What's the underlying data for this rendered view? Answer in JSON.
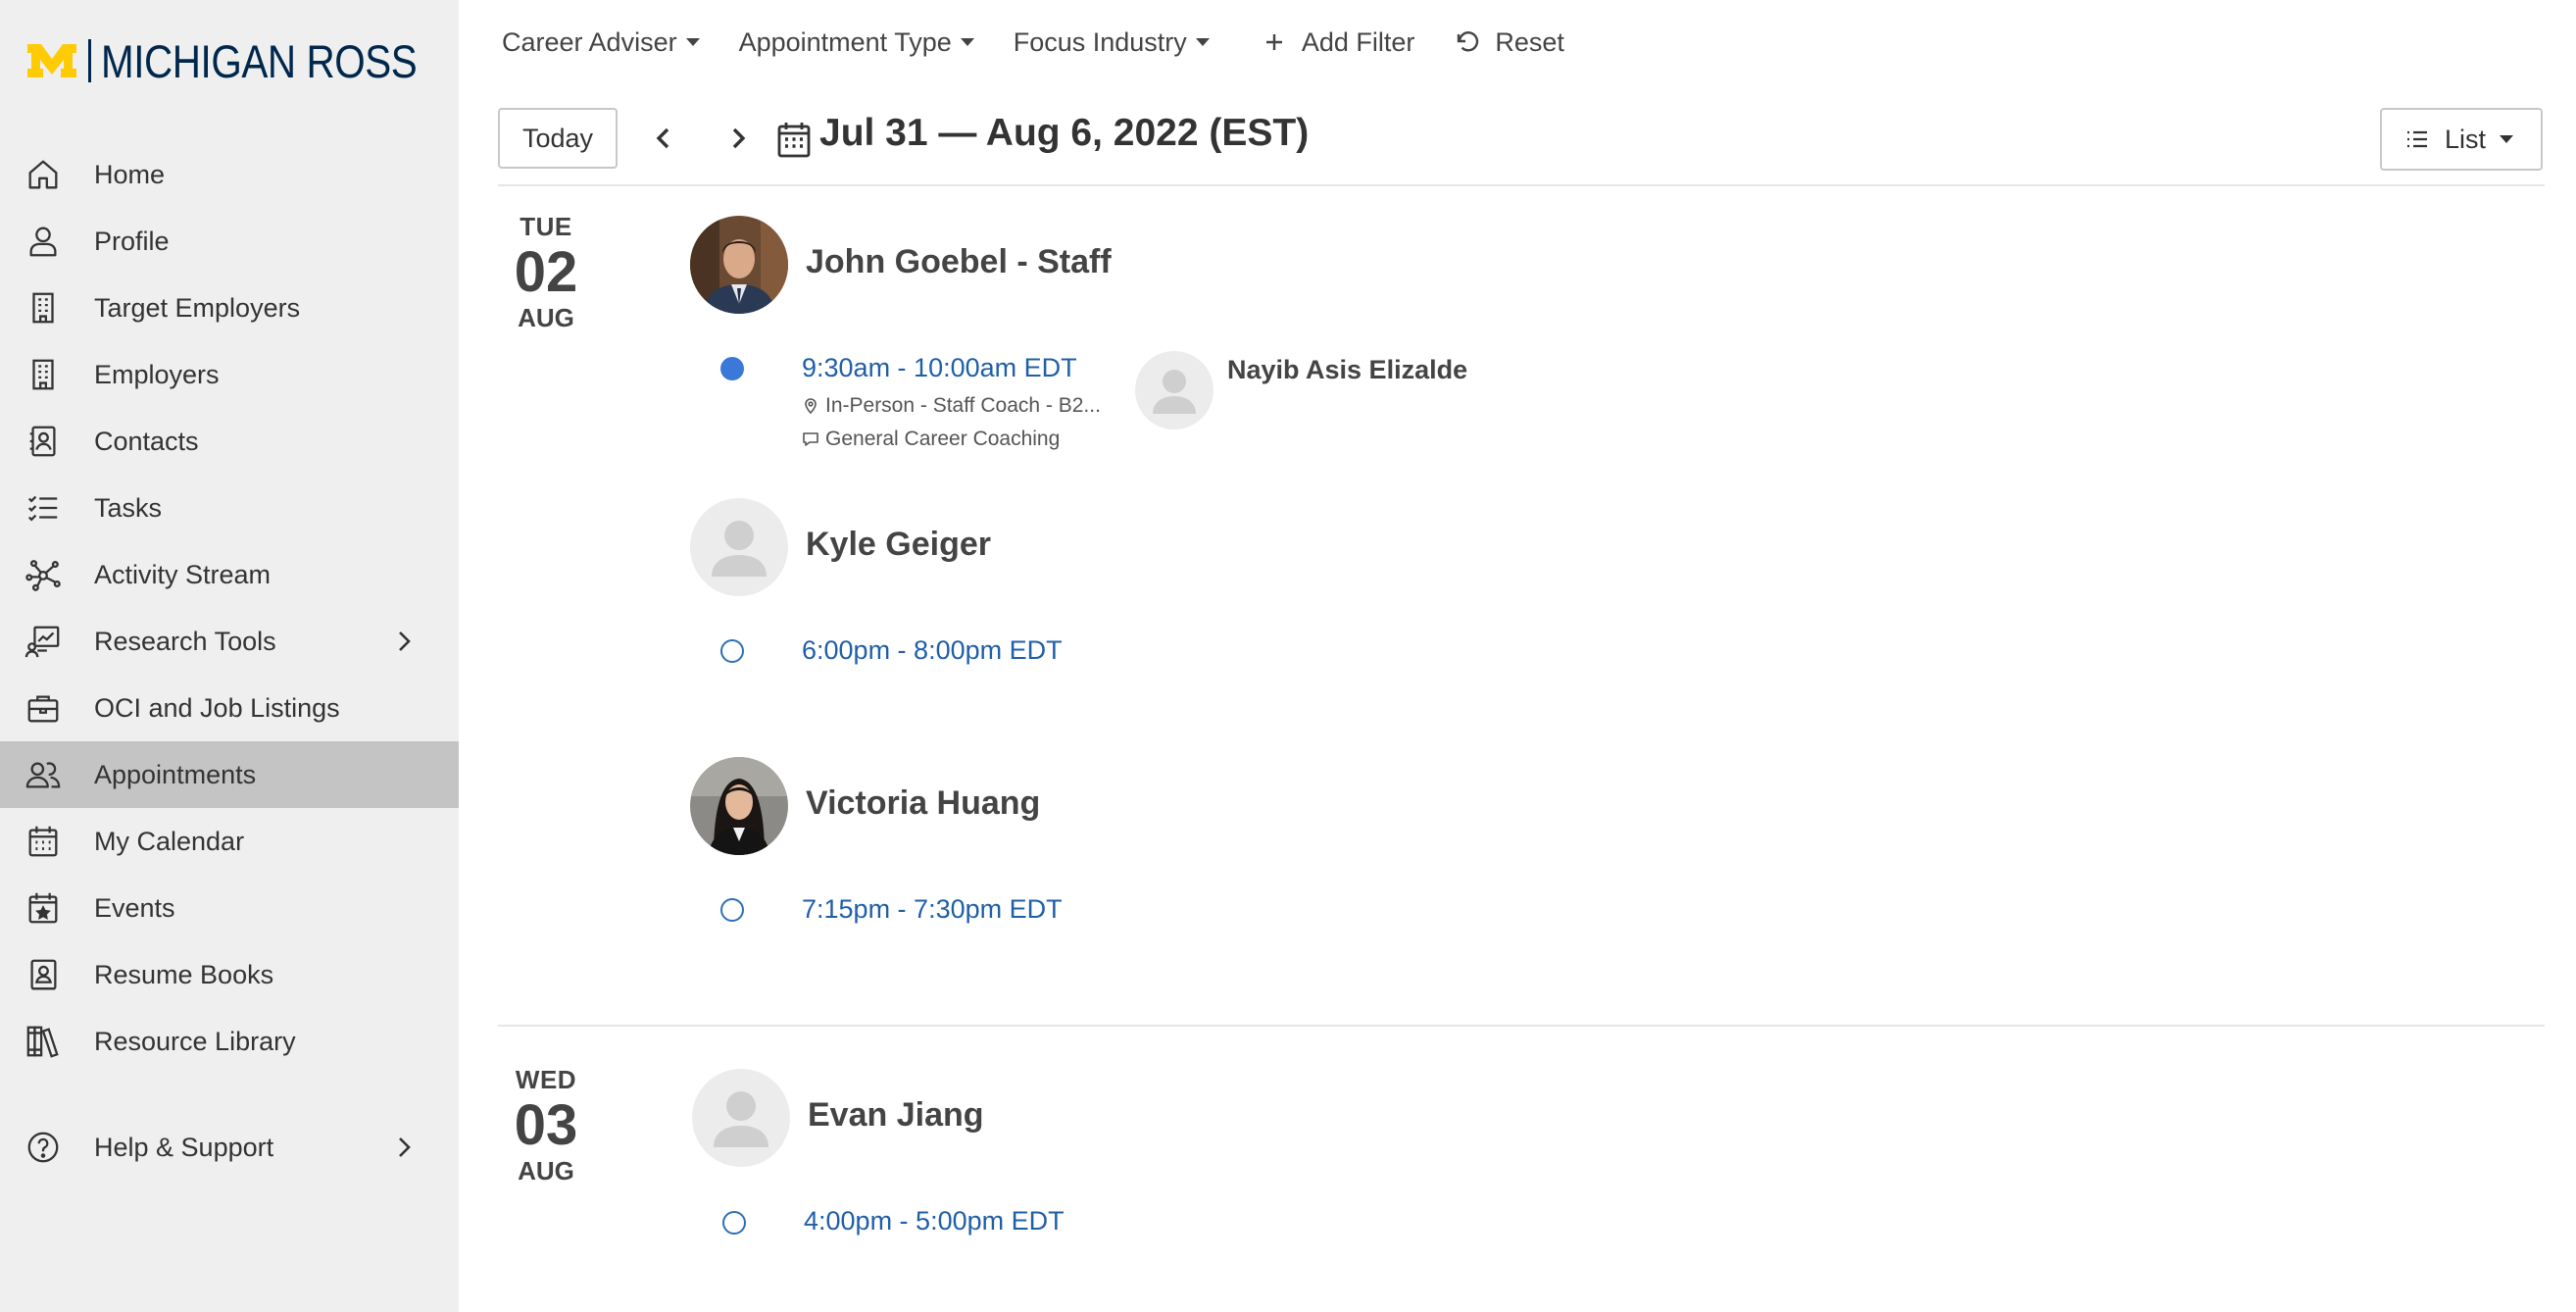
{
  "brand": {
    "name": "MICHIGAN ROSS",
    "accent": "#ffcb05",
    "navy": "#00274c"
  },
  "sidebar": {
    "items": [
      {
        "label": "Home",
        "icon": "home-icon"
      },
      {
        "label": "Profile",
        "icon": "user-icon"
      },
      {
        "label": "Target Employers",
        "icon": "building-icon"
      },
      {
        "label": "Employers",
        "icon": "building-icon"
      },
      {
        "label": "Contacts",
        "icon": "contact-card-icon"
      },
      {
        "label": "Tasks",
        "icon": "task-list-icon"
      },
      {
        "label": "Activity Stream",
        "icon": "network-icon"
      },
      {
        "label": "Research Tools",
        "icon": "chart-board-icon",
        "expandable": true
      },
      {
        "label": "OCI and Job Listings",
        "icon": "briefcase-icon"
      },
      {
        "label": "Appointments",
        "icon": "people-icon",
        "active": true
      },
      {
        "label": "My Calendar",
        "icon": "calendar-icon"
      },
      {
        "label": "Events",
        "icon": "calendar-star-icon"
      },
      {
        "label": "Resume Books",
        "icon": "resume-book-icon"
      },
      {
        "label": "Resource Library",
        "icon": "library-icon"
      }
    ],
    "help": {
      "label": "Help & Support",
      "icon": "help-circle-icon",
      "expandable": true
    }
  },
  "filters": {
    "career_adviser": "Career Adviser",
    "appointment_type": "Appointment Type",
    "focus_industry": "Focus Industry",
    "add_filter": "Add Filter",
    "reset": "Reset"
  },
  "toolbar": {
    "today": "Today",
    "range": "Jul 31 — Aug 6, 2022 (EST)",
    "view": "List"
  },
  "days": [
    {
      "dow": "TUE",
      "day": "02",
      "month": "AUG",
      "advisers": [
        {
          "name": "John Goebel - Staff",
          "photo": true,
          "slots": [
            {
              "time": "9:30am - 10:00am EDT",
              "booked": true,
              "location": "In-Person - Staff Coach - B2...",
              "topic": "General Career Coaching",
              "student": "Nayib Asis Elizalde"
            }
          ]
        },
        {
          "name": "Kyle Geiger",
          "photo": false,
          "slots": [
            {
              "time": "6:00pm - 8:00pm EDT",
              "booked": false
            }
          ]
        },
        {
          "name": "Victoria Huang",
          "photo": true,
          "slots": [
            {
              "time": "7:15pm - 7:30pm EDT",
              "booked": false
            }
          ]
        }
      ]
    },
    {
      "dow": "WED",
      "day": "03",
      "month": "AUG",
      "advisers": [
        {
          "name": "Evan Jiang",
          "photo": false,
          "slots": [
            {
              "time": "4:00pm - 5:00pm EDT",
              "booked": false
            }
          ]
        }
      ]
    }
  ]
}
